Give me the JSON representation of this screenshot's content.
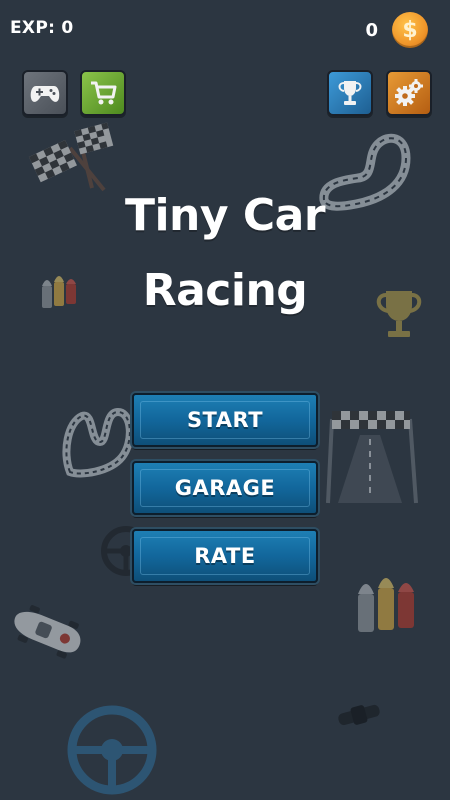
{
  "hud": {
    "exp_label": "EXP: 0",
    "coins": "0",
    "coin_symbol": "$"
  },
  "title": {
    "line1": "Tiny Car",
    "line2": "Racing"
  },
  "menu": {
    "start": "START",
    "garage": "GARAGE",
    "rate": "RATE"
  },
  "icons": {
    "top_left": [
      "gamepad-icon",
      "shop-cart-icon"
    ],
    "top_right": [
      "trophy-icon",
      "settings-gears-icon"
    ]
  },
  "colors": {
    "background": "#2c3641",
    "button_blue": "#12679c",
    "coin_gold": "#f0962a",
    "shop_green": "#6aa933",
    "trophy_blue": "#2b7bb6",
    "settings_orange": "#d17b22"
  }
}
